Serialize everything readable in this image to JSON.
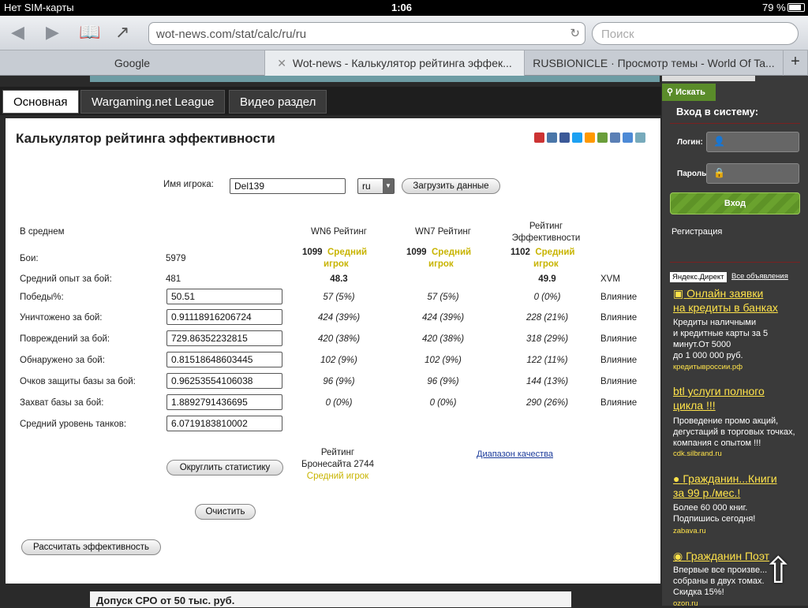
{
  "status": {
    "carrier": "Нет SIM-карты",
    "time": "1:06",
    "battery": "79 %"
  },
  "browser": {
    "url": "wot-news.com/stat/calc/ru/ru",
    "search_placeholder": "Поиск",
    "tabs": [
      {
        "label": "Google"
      },
      {
        "label": "Wot-news - Калькулятор рейтинга эффек...",
        "close": "✕"
      },
      {
        "label": "RUSBIONICLE · Просмотр темы - World Of Ta..."
      }
    ],
    "new_tab": "+"
  },
  "menu": {
    "items": [
      "Основная",
      "Wargaming.net League",
      "Видео раздел"
    ]
  },
  "calc": {
    "title": "Калькулятор рейтинга эффективности",
    "player_label": "Имя игрока:",
    "player_value": "Del139",
    "server": "ru",
    "load_button": "Загрузить данные",
    "headers": {
      "avg": "В среднем",
      "wn6": "WN6 Рейтинг",
      "wn7": "WN7 Рейтинг",
      "eff1": "Рейтинг",
      "eff2": "Эффективности"
    },
    "battles": {
      "label": "Бои:",
      "value": "5979",
      "wn6": "1099",
      "wn6_grade": "Средний",
      "wn6_grade2": "игрок",
      "wn7": "1099",
      "wn7_grade": "Средний",
      "wn7_grade2": "игрок",
      "eff": "1102",
      "eff_grade": "Средний",
      "eff_grade2": "игрок"
    },
    "avg_exp": {
      "label": "Средний опыт за бой:",
      "value": "481",
      "wn6": "48.3",
      "eff": "49.9",
      "xvm": "XVM"
    },
    "rows": [
      {
        "label": "Победы%:",
        "value": "50.51",
        "wn6": "57 (5%)",
        "wn7": "57 (5%)",
        "eff": "0 (0%)",
        "infl": "Влияние"
      },
      {
        "label": "Уничтожено за бой:",
        "value": "0.91118916206724",
        "wn6": "424 (39%)",
        "wn7": "424 (39%)",
        "eff": "228 (21%)",
        "infl": "Влияние"
      },
      {
        "label": "Повреждений за бой:",
        "value": "729.86352232815",
        "wn6": "420 (38%)",
        "wn7": "420 (38%)",
        "eff": "318 (29%)",
        "infl": "Влияние"
      },
      {
        "label": "Обнаружено за бой:",
        "value": "0.81518648603445",
        "wn6": "102 (9%)",
        "wn7": "102 (9%)",
        "eff": "122 (11%)",
        "infl": "Влияние"
      },
      {
        "label": "Очков защиты базы за бой:",
        "value": "0.96253554106038",
        "wn6": "96 (9%)",
        "wn7": "96 (9%)",
        "eff": "144 (13%)",
        "infl": "Влияние"
      },
      {
        "label": "Захват базы за бой:",
        "value": "1.8892791436695",
        "wn6": "0 (0%)",
        "wn7": "0 (0%)",
        "eff": "290 (26%)",
        "infl": "Влияние"
      },
      {
        "label": "Средний уровень танков:",
        "value": "6.0719183810002"
      }
    ],
    "round_button": "Округлить статистику",
    "armor_title": "Рейтинг",
    "armor_value": "Бронесайта 2744",
    "armor_grade": "Средний игрок",
    "quality_link": "Диапазон качества",
    "clear_button": "Очистить",
    "calc_button": "Рассчитать эффективность"
  },
  "bottom_ad": "Допуск СРО от 50 тыс. руб.",
  "sidebar": {
    "search_btn": "Искать",
    "login_header": "Вход в систему:",
    "login_label": "Логин:",
    "pass_label": "Пароль:",
    "login_btn": "Вход",
    "register": "Регистрация",
    "direct": "Яндекс.Директ",
    "all_ads": "Все объявления",
    "ads": [
      {
        "t1": "Онлайн заявки",
        "t2": "на кредиты в банках",
        "text": "Кредиты наличными\nи кредитные карты за 5\nминут.От 5000\nдо 1 000 000 руб.",
        "dom": "кредитывроссии.рф"
      },
      {
        "t1": "btl услуги полного",
        "t2": "цикла !!!",
        "text": "Проведение промо акций,\nдегустаций в торговых точках,\nкомпания с опытом !!!",
        "dom": "cdk.silbrand.ru"
      },
      {
        "t1": "Гражданин...Книги",
        "t2": "за 99 р./мес.!",
        "text": "Более 60 000 книг.\nПодпишись сегодня!",
        "dom": "zabava.ru"
      },
      {
        "t1": "Гражданин Поэт",
        "text": "Впервые все произве...\nсобраны в двух томах.\nСкидка 15%!",
        "dom": "ozon.ru"
      }
    ]
  },
  "colors": {
    "grade": "#c8b400",
    "ad_title": "#ffe34a",
    "green": "#5e9327"
  }
}
